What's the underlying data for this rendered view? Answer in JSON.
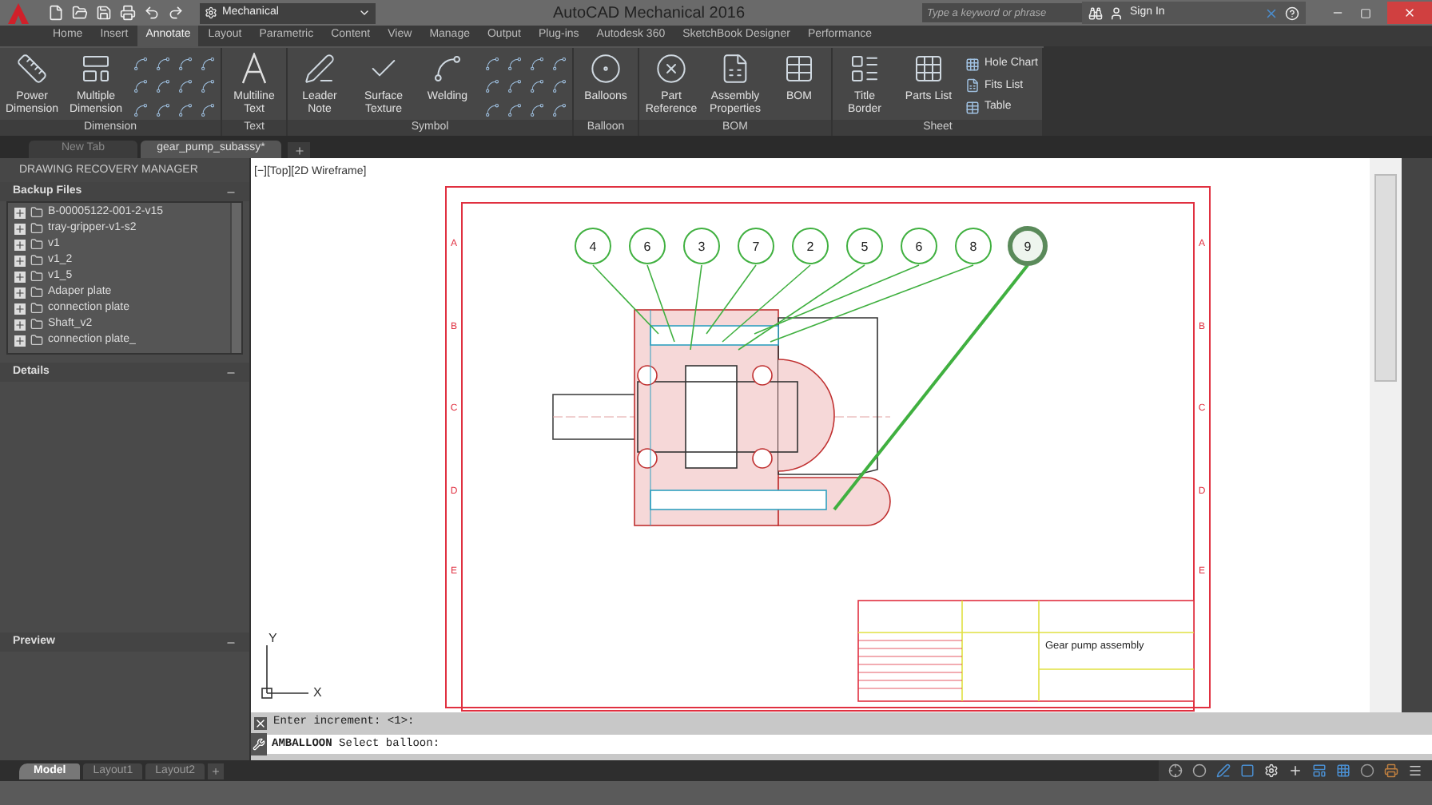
{
  "title_bar": {
    "workspace": "Mechanical",
    "title": "AutoCAD Mechanical 2016",
    "search": {
      "placeholder": "Type a keyword or phrase"
    },
    "sign_in": "Sign In"
  },
  "ribbon_tabs": [
    {
      "label": "Home",
      "selected": false
    },
    {
      "label": "Insert",
      "selected": false
    },
    {
      "label": "Annotate",
      "selected": true
    },
    {
      "label": "Layout",
      "selected": false
    },
    {
      "label": "Parametric",
      "selected": false
    },
    {
      "label": "Content",
      "selected": false
    },
    {
      "label": "View",
      "selected": false
    },
    {
      "label": "Manage",
      "selected": false
    },
    {
      "label": "Output",
      "selected": false
    },
    {
      "label": "Plug-ins",
      "selected": false
    },
    {
      "label": "Autodesk 360",
      "selected": false
    },
    {
      "label": "SketchBook Designer",
      "selected": false
    },
    {
      "label": "Performance",
      "selected": false
    }
  ],
  "ribbon_panels": [
    {
      "title": "Dimension",
      "tools": true,
      "buttons": [
        "Power Dimension",
        "Multiple Dimension"
      ]
    },
    {
      "title": "Text",
      "tools": false,
      "buttons": [
        "Multiline Text"
      ]
    },
    {
      "title": "Symbol",
      "tools": true,
      "buttons": [
        "Leader Note",
        "Surface Texture",
        "Welding"
      ]
    },
    {
      "title": "Balloon",
      "tools": false,
      "buttons": [
        "Balloons"
      ]
    },
    {
      "title": "BOM",
      "tools": false,
      "buttons": [
        "Part Reference",
        "Assembly Properties",
        "BOM"
      ]
    },
    {
      "title": "Sheet",
      "tools": false,
      "buttons": [
        "Title Border",
        "Parts List"
      ],
      "small_buttons": [
        "Hole Chart",
        "Fits List",
        "Table"
      ]
    }
  ],
  "document_tabs": [
    {
      "label": "New Tab",
      "selected": false
    },
    {
      "label": "gear_pump_subassy*",
      "selected": true
    }
  ],
  "recovery_manager": {
    "title": "DRAWING RECOVERY MANAGER",
    "backup_files": {
      "title": "Backup Files",
      "items": [
        "B-00005122-001-2-v15",
        "tray-gripper-v1-s2",
        "v1",
        "v1_2",
        "v1_5",
        "Adaper plate",
        "connection plate",
        "Shaft_v2",
        "connection plate_"
      ]
    },
    "details": {
      "title": "Details"
    },
    "preview": {
      "title": "Preview"
    }
  },
  "canvas": {
    "viewport_label": "[−][Top][2D Wireframe]",
    "border_rows_left": [
      "A",
      "B",
      "C",
      "D",
      "E"
    ],
    "border_rows_right": [
      "A",
      "B",
      "C",
      "D",
      "E"
    ],
    "balloons": [
      {
        "number": "4",
        "selected": false
      },
      {
        "number": "6",
        "selected": false
      },
      {
        "number": "3",
        "selected": false
      },
      {
        "number": "7",
        "selected": false
      },
      {
        "number": "2",
        "selected": false
      },
      {
        "number": "5",
        "selected": false
      },
      {
        "number": "6",
        "selected": false
      },
      {
        "number": "8",
        "selected": false
      },
      {
        "number": "9",
        "selected": true
      }
    ],
    "title_block": {
      "title": "Gear pump assembly"
    },
    "ucs": {
      "x": "X",
      "y": "Y"
    }
  },
  "command_line": {
    "history": "Enter increment: <1>:",
    "prompt": "**AMBALLOON** Select balloon:"
  },
  "layout_tabs": [
    {
      "label": "Model",
      "kind": "model",
      "selected": true
    },
    {
      "label": "Layout1",
      "kind": "layout",
      "selected": false
    },
    {
      "label": "Layout2",
      "kind": "layout",
      "selected": false
    }
  ]
}
